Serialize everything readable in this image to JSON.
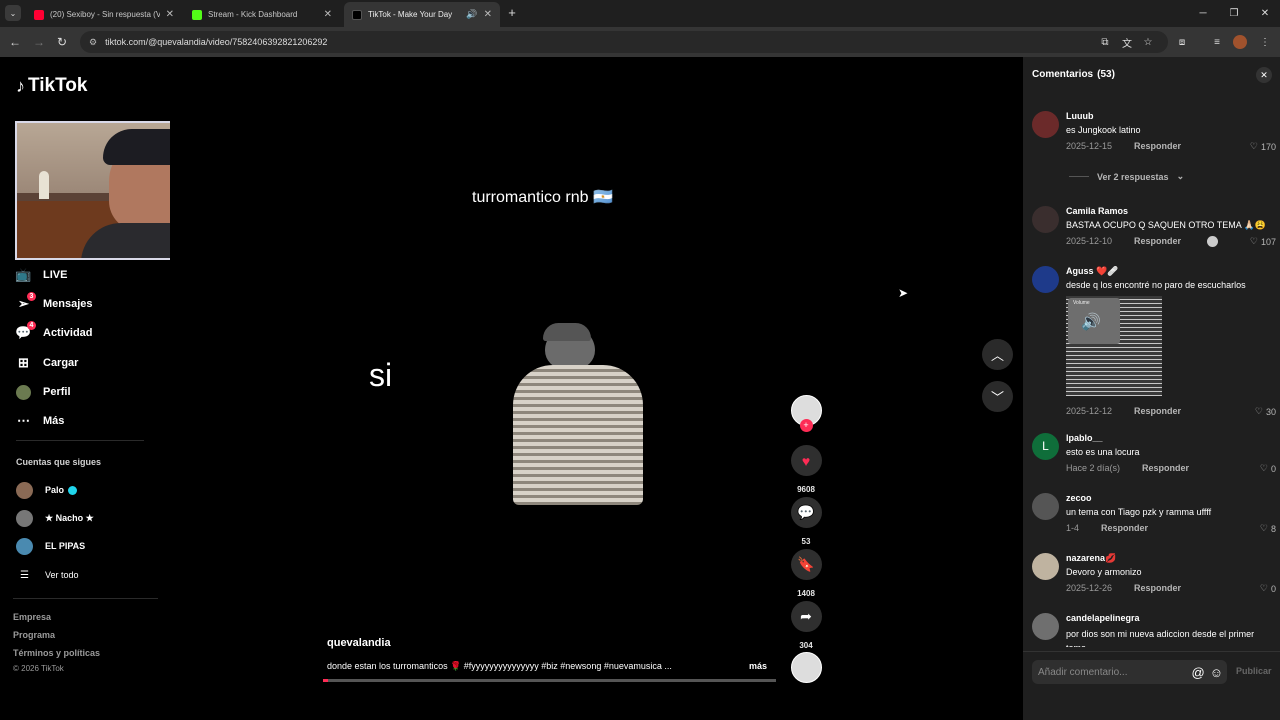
{
  "browser": {
    "tabs": [
      {
        "title": "(20) Sexiboy - Sin respuesta (Vi",
        "favicon_color": "#ff0033",
        "active": false
      },
      {
        "title": "Stream - Kick Dashboard",
        "favicon_color": "#53fc18",
        "active": false
      },
      {
        "title": "TikTok - Make Your Day",
        "favicon_color": "#000000",
        "active": true
      }
    ],
    "url": "tiktok.com/@quevalandia/video/7582406392821206292"
  },
  "sidebar": {
    "logo": "TikTok",
    "nav": [
      {
        "label": "LIVE",
        "icon": "live-icon",
        "badge": ""
      },
      {
        "label": "Mensajes",
        "icon": "messages-icon",
        "badge": "3"
      },
      {
        "label": "Actividad",
        "icon": "activity-icon",
        "badge": "4"
      },
      {
        "label": "Cargar",
        "icon": "upload-icon",
        "badge": ""
      },
      {
        "label": "Perfil",
        "icon": "profile-icon",
        "badge": ""
      },
      {
        "label": "Más",
        "icon": "more-icon",
        "badge": ""
      }
    ],
    "following_title": "Cuentas que sigues",
    "following": [
      {
        "name": "Palo",
        "verified": true
      },
      {
        "name": "★ Nacho ★",
        "verified": false
      },
      {
        "name": "EL PIPAS",
        "verified": false
      }
    ],
    "see_all": "Ver todo",
    "footer": [
      "Empresa",
      "Programa",
      "Términos y políticas"
    ],
    "copyright": "© 2026 TikTok"
  },
  "video": {
    "title_overlay": "turromantico rnb 🇦🇷",
    "caption_overlay": "si",
    "author": "quevalandia",
    "description": "donde estan los turromanticos 🌹 #fyyyyyyyyyyyyyyy #biz #newsong #nuevamusica ...",
    "more": "más",
    "likes": "9608",
    "comments": "53",
    "saves": "1408",
    "shares": "304",
    "progress": 0.01
  },
  "comments_panel": {
    "title": "Comentarios",
    "count": "(53)",
    "reply_label": "Responder",
    "input_placeholder": "Añadir comentario...",
    "post_label": "Publicar",
    "view_replies": "Ver 2 respuestas",
    "items": [
      {
        "user": "Luuub",
        "text": "es Jungkook latino",
        "date": "2025-12-15",
        "likes": "170"
      },
      {
        "user": "Camila Ramos",
        "text": "BASTAA OCUPO Q SAQUEN OTRO TEMA 🙏🏻😩",
        "date": "2025-12-10",
        "likes": "107"
      },
      {
        "user": "Aguss ❤️🩹",
        "text": "desde q los encontré no paro de escucharlos",
        "date": "2025-12-12",
        "likes": "30",
        "image_label": "Volume"
      },
      {
        "user": "lpablo__",
        "text": "esto es una locura",
        "date": "Hace 2 día(s)",
        "likes": "0"
      },
      {
        "user": "zecoo",
        "text": "un tema con Tiago pzk y ramma uffff",
        "date": "1-4",
        "likes": "8"
      },
      {
        "user": "nazarena💋",
        "text": "Devoro y armonizo",
        "date": "2025-12-26",
        "likes": "0"
      },
      {
        "user": "candelapelinegra",
        "text": "por dios son mi nueva adiccion desde el primer tema",
        "date": "",
        "likes": ""
      }
    ]
  },
  "webcam": {
    "brand": "logi"
  }
}
